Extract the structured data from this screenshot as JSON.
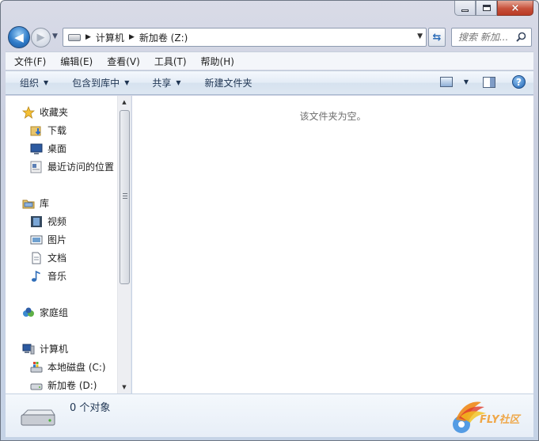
{
  "window": {
    "caption": {
      "minimize": "minimize",
      "maximize": "maximize",
      "close": "×"
    }
  },
  "nav": {
    "breadcrumb": [
      "计算机",
      "新加卷 (Z:)"
    ],
    "search_placeholder": "搜索 新加..."
  },
  "menu": [
    "文件(F)",
    "编辑(E)",
    "查看(V)",
    "工具(T)",
    "帮助(H)"
  ],
  "commands": {
    "organize": "组织",
    "include_in_library": "包含到库中",
    "share": "共享",
    "new_folder": "新建文件夹"
  },
  "sidebar": {
    "favorites": {
      "label": "收藏夹",
      "items": [
        "下载",
        "桌面",
        "最近访问的位置"
      ]
    },
    "libraries": {
      "label": "库",
      "items": [
        "视频",
        "图片",
        "文档",
        "音乐"
      ]
    },
    "homegroup": {
      "label": "家庭组"
    },
    "computer": {
      "label": "计算机",
      "items": [
        "本地磁盘 (C:)",
        "新加卷 (D:)"
      ]
    }
  },
  "content": {
    "empty_message": "该文件夹为空。"
  },
  "details": {
    "item_count": "0 个对象"
  },
  "watermark": {
    "text": "FLY社区"
  },
  "colors": {
    "accent": "#2f7bc8",
    "close": "#c7503a",
    "window_frame": "#c9cfe0"
  }
}
